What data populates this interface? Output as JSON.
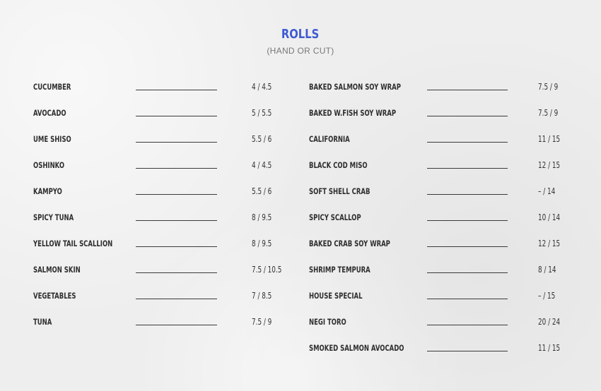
{
  "header": {
    "title": "ROLLS",
    "subtitle": "(HAND OR CUT)"
  },
  "left_items": [
    {
      "name": "CUCUMBER",
      "price": "4 / 4.5"
    },
    {
      "name": "AVOCADO",
      "price": "5 / 5.5"
    },
    {
      "name": "UME SHISO",
      "price": "5.5 / 6"
    },
    {
      "name": "OSHINKO",
      "price": "4 / 4.5"
    },
    {
      "name": "KAMPYO",
      "price": "5.5 / 6"
    },
    {
      "name": "SPICY TUNA",
      "price": "8 / 9.5"
    },
    {
      "name": "YELLOW TAIL SCALLION",
      "price": "8 / 9.5"
    },
    {
      "name": "SALMON SKIN",
      "price": "7.5 / 10.5"
    },
    {
      "name": "VEGETABLES",
      "price": "7 / 8.5"
    },
    {
      "name": "TUNA",
      "price": "7.5 / 9"
    }
  ],
  "right_items": [
    {
      "name": "BAKED SALMON SOY WRAP",
      "price": "7.5 / 9"
    },
    {
      "name": "BAKED W.FISH SOY WRAP",
      "price": "7.5 / 9"
    },
    {
      "name": "CALIFORNIA",
      "price": "11 / 15"
    },
    {
      "name": "BLACK COD MISO",
      "price": "12 / 15"
    },
    {
      "name": "SOFT SHELL CRAB",
      "price": "– / 14"
    },
    {
      "name": "SPICY SCALLOP",
      "price": "10 / 14"
    },
    {
      "name": "BAKED CRAB SOY WRAP",
      "price": "12 / 15"
    },
    {
      "name": "SHRIMP TEMPURA",
      "price": "8 / 14"
    },
    {
      "name": "HOUSE SPECIAL",
      "price": "– / 15"
    },
    {
      "name": "NEGI TORO",
      "price": "20 / 24"
    },
    {
      "name": "SMOKED SALMON AVOCADO",
      "price": "11 / 15"
    }
  ],
  "colors": {
    "title": "#3f5bd3",
    "background": "#eeeeee",
    "text": "#2e2e2e"
  }
}
